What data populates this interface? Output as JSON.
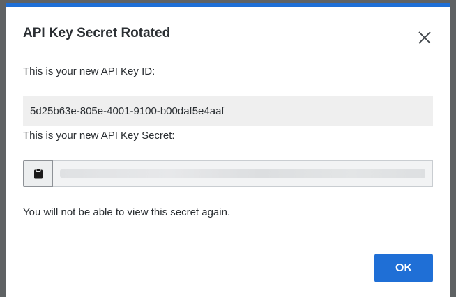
{
  "dialog": {
    "title": "API Key Secret Rotated",
    "key_id_label": "This is your new API Key ID:",
    "key_id_value": "5d25b63e-805e-4001-9100-b00daf5e4aaf",
    "secret_label": "This is your new API Key Secret:",
    "warning_text": "You will not be able to view this secret again.",
    "ok_label": "OK"
  },
  "icons": {
    "close": "close-icon",
    "copy": "clipboard-icon"
  },
  "colors": {
    "accent": "#1f6fd6",
    "backdrop": "#5f6264",
    "key_id_background": "#efefef"
  }
}
